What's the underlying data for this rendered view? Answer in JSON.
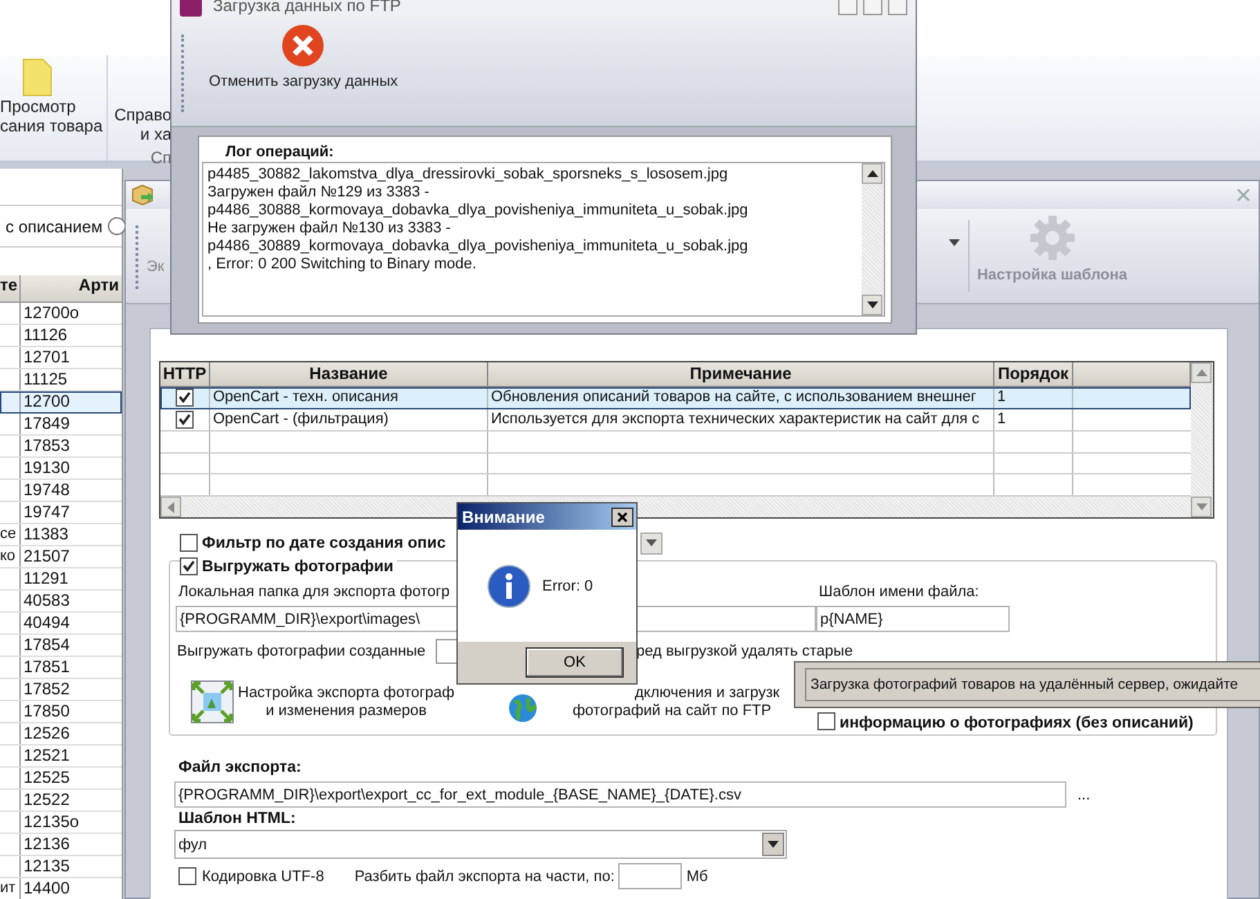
{
  "main_window": {
    "ribbon": {
      "buttons": [
        {
          "lines": [
            "Просмотр",
            "сания товара"
          ]
        },
        {
          "lines": [
            "Справо",
            "и ха"
          ]
        }
      ],
      "group_label": "Сп"
    },
    "filter": {
      "label": "с описанием"
    },
    "next_radio": {
      "selected": false
    },
    "table": {
      "columns": [
        "те",
        "Арти"
      ],
      "rows": [
        {
          "column_2": "12700o",
          "selected": false
        },
        {
          "column_2": "11126",
          "selected": false
        },
        {
          "column_2": "12701",
          "selected": false
        },
        {
          "column_2": "11125",
          "selected": false
        },
        {
          "column_2": "12700",
          "selected": true
        },
        {
          "column_2": "17849",
          "selected": false
        },
        {
          "column_2": "17853",
          "selected": false
        },
        {
          "column_2": "19130",
          "selected": false
        },
        {
          "column_2": "19748",
          "selected": false
        },
        {
          "column_2": "19747",
          "selected": false
        },
        {
          "column_1": "се",
          "column_2": "11383",
          "selected": false
        },
        {
          "column_1": "ко",
          "column_2": "21507",
          "selected": false
        },
        {
          "column_2": "11291",
          "selected": false
        },
        {
          "column_2": "40583",
          "selected": false
        },
        {
          "column_2": "40494",
          "selected": false
        },
        {
          "column_2": "17854",
          "selected": false
        },
        {
          "column_2": "17851",
          "selected": false
        },
        {
          "column_2": "17852",
          "selected": false
        },
        {
          "column_2": "17850",
          "selected": false
        },
        {
          "column_2": "12526",
          "selected": false
        },
        {
          "column_2": "12521",
          "selected": false
        },
        {
          "column_2": "12525",
          "selected": false
        },
        {
          "column_2": "12522",
          "selected": false
        },
        {
          "column_2": "12135o",
          "selected": false
        },
        {
          "column_2": "12136",
          "selected": false
        },
        {
          "column_2": "12135",
          "selected": false
        },
        {
          "column_1": "ит",
          "column_2": "14400",
          "selected": false
        }
      ]
    }
  },
  "export_window": {
    "toolbar": {
      "button_fragment": "Эк",
      "template_button": {
        "label": "Настройка шаблона",
        "disabled": true
      }
    },
    "grid": {
      "columns": [
        "HTTP",
        "Название",
        "Примечание",
        "Порядок"
      ],
      "rows": [
        {
          "http": true,
          "name": "OpenCart - техн. описания",
          "note": "Обновления описаний товаров на сайте, с использованием внешнег",
          "order": "1",
          "selected": true
        },
        {
          "http": true,
          "name": "OpenCart - (фильтрация)",
          "note": "Используется для экспорта технических характеристик на сайт для с",
          "order": "1",
          "selected": false
        }
      ]
    },
    "date_filter": {
      "label": "Фильтр по дате создания опис",
      "checked": false
    },
    "photos": {
      "label": "Выгружать фотографии",
      "checked": true,
      "folder_label": "Локальная папка для экспорта фотогр",
      "folder": "{PROGRAMM_DIR}\\export\\images\\",
      "name_template_label": "Шаблон имени файла:",
      "name_template": "p{NAME}",
      "created_label": "Выгружать фотографии созданные",
      "delete_old_fragment": "ред выгрузкой удалять старые",
      "resize_button": [
        "Настройка экспорта фотограф",
        "и изменения размеров"
      ],
      "ftp_button": [
        "дключения и загрузк",
        "фотографий на сайт по FTP"
      ],
      "info_only": {
        "label": "информацию о фотографиях (без описаний)",
        "checked": false
      }
    },
    "export_file": {
      "label": "Файл экспорта:",
      "value": "{PROGRAMM_DIR}\\export\\export_cc_for_ext_module_{BASE_NAME}_{DATE}.csv",
      "browse": "..."
    },
    "html_template": {
      "label": "Шаблон HTML:",
      "value": "фул"
    },
    "utf8": {
      "label": "Кодировка UTF-8",
      "checked": false
    },
    "split": {
      "label": "Разбить файл экспорта на части, по:",
      "unit": "Мб"
    }
  },
  "ftp_window": {
    "title": "Загрузка данных по FTP",
    "cancel_button": "Отменить загрузку данных",
    "log_label": "Лог операций:",
    "log_lines": [
      "p4485_30882_lakomstva_dlya_dressirovki_sobak_sporsneks_s_lososem.jpg",
      "Загружен файл №129 из 3383 -",
      "p4486_30888_kormovaya_dobavka_dlya_povisheniya_immuniteta_u_sobak.jpg",
      "Не загружен файл №130 из 3383 -",
      "p4486_30889_kormovaya_dobavka_dlya_povisheniya_immuniteta_u_sobak.jpg",
      ", Error: 0 200 Switching to Binary mode."
    ]
  },
  "message_box": {
    "title": "Внимание",
    "message": "Error: 0",
    "ok": "OK"
  },
  "tooltip": {
    "text": "Загрузка фотографий товаров на удалённый сервер, ожидайте"
  }
}
